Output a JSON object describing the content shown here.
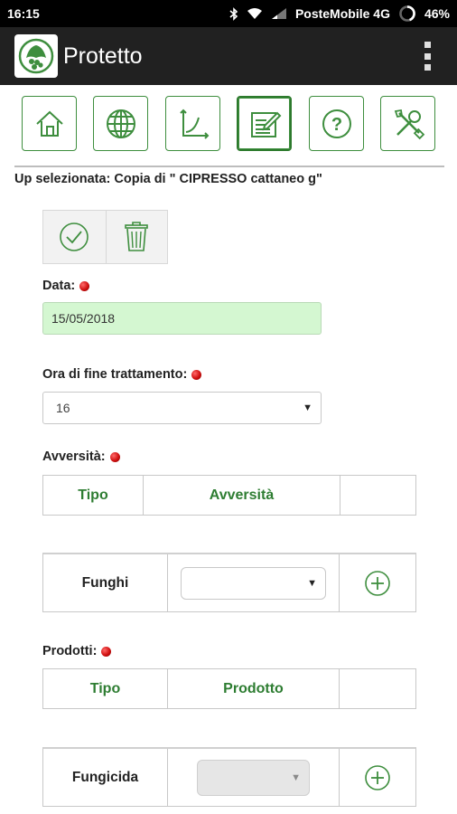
{
  "status_bar": {
    "time": "16:15",
    "carrier": "PosteMobile 4G",
    "battery": "46%"
  },
  "app_bar": {
    "title": "Protetto"
  },
  "toolbar": {
    "icons": [
      "home-icon",
      "globe-icon",
      "chart-icon",
      "edit-form-icon",
      "help-icon",
      "tools-icon"
    ],
    "active_index": 3
  },
  "selected_up": "Up selezionata: Copia di \" CIPRESSO cattaneo g\"",
  "form": {
    "date_label": "Data:",
    "date_value": "15/05/2018",
    "end_time_label": "Ora di fine trattamento:",
    "end_time_value": "16",
    "adversity_label": "Avversità:",
    "products_label": "Prodotti:"
  },
  "adversity_table": {
    "headers": [
      "Tipo",
      "Avversità",
      ""
    ],
    "row_type": "Funghi",
    "row_select_value": ""
  },
  "products_table": {
    "headers": [
      "Tipo",
      "Prodotto",
      ""
    ],
    "row_type": "Fungicida",
    "row_select_value": ""
  },
  "colors": {
    "accent_green": "#2e7d32",
    "date_bg": "#d4f7d1",
    "app_bar": "#212121",
    "required_dot": "#d01010"
  }
}
